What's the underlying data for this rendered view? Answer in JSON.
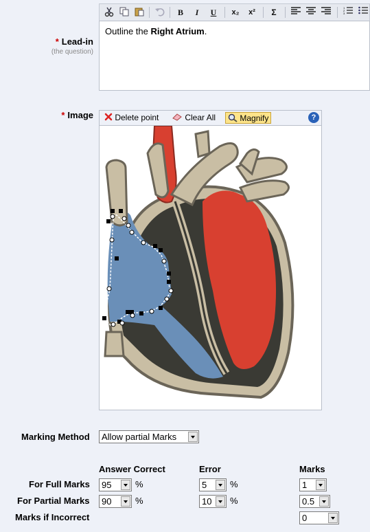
{
  "leadin": {
    "label": "Lead-in",
    "required_mark": "*",
    "sublabel": "(the question)",
    "text_prefix": "Outline the ",
    "text_bold": "Right Atrium",
    "text_suffix": "."
  },
  "toolbar": {
    "bold": "B",
    "italic": "I",
    "underline": "U",
    "subscript": "x₂",
    "superscript": "x²",
    "symbol": "Σ",
    "icons": [
      "cut-icon",
      "copy-icon",
      "paste-icon",
      "undo-icon",
      "bold-icon",
      "italic-icon",
      "underline-icon",
      "subscript-icon",
      "superscript-icon",
      "symbol-icon",
      "align-left-icon",
      "align-center-icon",
      "align-right-icon",
      "ordered-list-icon",
      "unordered-list-icon"
    ]
  },
  "image": {
    "label": "Image",
    "required_mark": "*",
    "delete_point": "Delete point",
    "clear_all": "Clear All",
    "magnify": "Magnify",
    "help": "?"
  },
  "marking": {
    "label": "Marking Method",
    "value": "Allow partial Marks"
  },
  "table": {
    "col_answer": "Answer Correct",
    "col_error": "Error",
    "col_marks": "Marks",
    "pct": "%",
    "full": {
      "label": "For Full Marks",
      "answer": "95",
      "error": "5",
      "marks": "1"
    },
    "partial": {
      "label": "For Partial Marks",
      "answer": "90",
      "error": "10",
      "marks": "0.5"
    },
    "incorrect": {
      "label": "Marks if Incorrect",
      "marks": "0"
    }
  },
  "colors": {
    "accent_red": "#cc0000",
    "atrium_blue": "#6a8fb8",
    "heart_red": "#d84030",
    "magnify_bg": "#fde48a"
  }
}
